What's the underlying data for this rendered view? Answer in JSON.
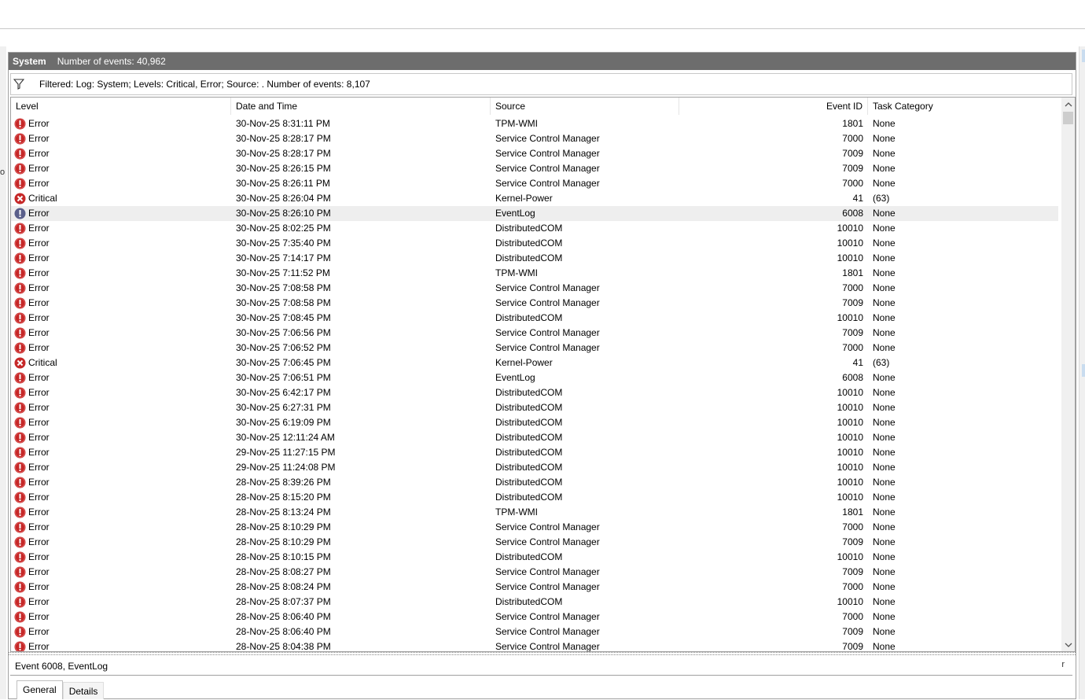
{
  "panel": {
    "log_name": "System",
    "event_count": "Number of events: 40,962"
  },
  "filter": {
    "text": "Filtered: Log: System; Levels: Critical, Error; Source: . Number of events: 8,107"
  },
  "columns": [
    "Level",
    "Date and Time",
    "Source",
    "Event ID",
    "Task Category"
  ],
  "icons": {
    "error": "error-icon",
    "critical": "critical-icon",
    "filter": "filter-icon"
  },
  "colors": {
    "error_red": "#c62828",
    "header_gray": "#6d6d6d",
    "selected_row": "#eeeeee"
  },
  "rows": [
    {
      "level": "Error",
      "date": "30-Nov-25 8:31:11 PM",
      "source": "TPM-WMI",
      "event_id": "1801",
      "category": "None"
    },
    {
      "level": "Error",
      "date": "30-Nov-25 8:28:17 PM",
      "source": "Service Control Manager",
      "event_id": "7000",
      "category": "None"
    },
    {
      "level": "Error",
      "date": "30-Nov-25 8:28:17 PM",
      "source": "Service Control Manager",
      "event_id": "7009",
      "category": "None"
    },
    {
      "level": "Error",
      "date": "30-Nov-25 8:26:15 PM",
      "source": "Service Control Manager",
      "event_id": "7009",
      "category": "None"
    },
    {
      "level": "Error",
      "date": "30-Nov-25 8:26:11 PM",
      "source": "Service Control Manager",
      "event_id": "7000",
      "category": "None"
    },
    {
      "level": "Critical",
      "date": "30-Nov-25 8:26:04 PM",
      "source": "Kernel-Power",
      "event_id": "41",
      "category": "(63)"
    },
    {
      "level": "Error",
      "date": "30-Nov-25 8:26:10 PM",
      "source": "EventLog",
      "event_id": "6008",
      "category": "None",
      "selected": true
    },
    {
      "level": "Error",
      "date": "30-Nov-25 8:02:25 PM",
      "source": "DistributedCOM",
      "event_id": "10010",
      "category": "None"
    },
    {
      "level": "Error",
      "date": "30-Nov-25 7:35:40 PM",
      "source": "DistributedCOM",
      "event_id": "10010",
      "category": "None"
    },
    {
      "level": "Error",
      "date": "30-Nov-25 7:14:17 PM",
      "source": "DistributedCOM",
      "event_id": "10010",
      "category": "None"
    },
    {
      "level": "Error",
      "date": "30-Nov-25 7:11:52 PM",
      "source": "TPM-WMI",
      "event_id": "1801",
      "category": "None"
    },
    {
      "level": "Error",
      "date": "30-Nov-25 7:08:58 PM",
      "source": "Service Control Manager",
      "event_id": "7000",
      "category": "None"
    },
    {
      "level": "Error",
      "date": "30-Nov-25 7:08:58 PM",
      "source": "Service Control Manager",
      "event_id": "7009",
      "category": "None"
    },
    {
      "level": "Error",
      "date": "30-Nov-25 7:08:45 PM",
      "source": "DistributedCOM",
      "event_id": "10010",
      "category": "None"
    },
    {
      "level": "Error",
      "date": "30-Nov-25 7:06:56 PM",
      "source": "Service Control Manager",
      "event_id": "7009",
      "category": "None"
    },
    {
      "level": "Error",
      "date": "30-Nov-25 7:06:52 PM",
      "source": "Service Control Manager",
      "event_id": "7000",
      "category": "None"
    },
    {
      "level": "Critical",
      "date": "30-Nov-25 7:06:45 PM",
      "source": "Kernel-Power",
      "event_id": "41",
      "category": "(63)"
    },
    {
      "level": "Error",
      "date": "30-Nov-25 7:06:51 PM",
      "source": "EventLog",
      "event_id": "6008",
      "category": "None"
    },
    {
      "level": "Error",
      "date": "30-Nov-25 6:42:17 PM",
      "source": "DistributedCOM",
      "event_id": "10010",
      "category": "None"
    },
    {
      "level": "Error",
      "date": "30-Nov-25 6:27:31 PM",
      "source": "DistributedCOM",
      "event_id": "10010",
      "category": "None"
    },
    {
      "level": "Error",
      "date": "30-Nov-25 6:19:09 PM",
      "source": "DistributedCOM",
      "event_id": "10010",
      "category": "None"
    },
    {
      "level": "Error",
      "date": "30-Nov-25 12:11:24 AM",
      "source": "DistributedCOM",
      "event_id": "10010",
      "category": "None"
    },
    {
      "level": "Error",
      "date": "29-Nov-25 11:27:15 PM",
      "source": "DistributedCOM",
      "event_id": "10010",
      "category": "None"
    },
    {
      "level": "Error",
      "date": "29-Nov-25 11:24:08 PM",
      "source": "DistributedCOM",
      "event_id": "10010",
      "category": "None"
    },
    {
      "level": "Error",
      "date": "28-Nov-25 8:39:26 PM",
      "source": "DistributedCOM",
      "event_id": "10010",
      "category": "None"
    },
    {
      "level": "Error",
      "date": "28-Nov-25 8:15:20 PM",
      "source": "DistributedCOM",
      "event_id": "10010",
      "category": "None"
    },
    {
      "level": "Error",
      "date": "28-Nov-25 8:13:24 PM",
      "source": "TPM-WMI",
      "event_id": "1801",
      "category": "None"
    },
    {
      "level": "Error",
      "date": "28-Nov-25 8:10:29 PM",
      "source": "Service Control Manager",
      "event_id": "7000",
      "category": "None"
    },
    {
      "level": "Error",
      "date": "28-Nov-25 8:10:29 PM",
      "source": "Service Control Manager",
      "event_id": "7009",
      "category": "None"
    },
    {
      "level": "Error",
      "date": "28-Nov-25 8:10:15 PM",
      "source": "DistributedCOM",
      "event_id": "10010",
      "category": "None"
    },
    {
      "level": "Error",
      "date": "28-Nov-25 8:08:27 PM",
      "source": "Service Control Manager",
      "event_id": "7009",
      "category": "None"
    },
    {
      "level": "Error",
      "date": "28-Nov-25 8:08:24 PM",
      "source": "Service Control Manager",
      "event_id": "7000",
      "category": "None"
    },
    {
      "level": "Error",
      "date": "28-Nov-25 8:07:37 PM",
      "source": "DistributedCOM",
      "event_id": "10010",
      "category": "None"
    },
    {
      "level": "Error",
      "date": "28-Nov-25 8:06:40 PM",
      "source": "Service Control Manager",
      "event_id": "7000",
      "category": "None"
    },
    {
      "level": "Error",
      "date": "28-Nov-25 8:06:40 PM",
      "source": "Service Control Manager",
      "event_id": "7009",
      "category": "None"
    },
    {
      "level": "Error",
      "date": "28-Nov-25 8:04:38 PM",
      "source": "Service Control Manager",
      "event_id": "7009",
      "category": "None"
    }
  ],
  "detail": {
    "title": "Event 6008, EventLog",
    "close_glyph": "r",
    "tabs": [
      "General",
      "Details"
    ]
  },
  "left_edge_glyph": "o"
}
